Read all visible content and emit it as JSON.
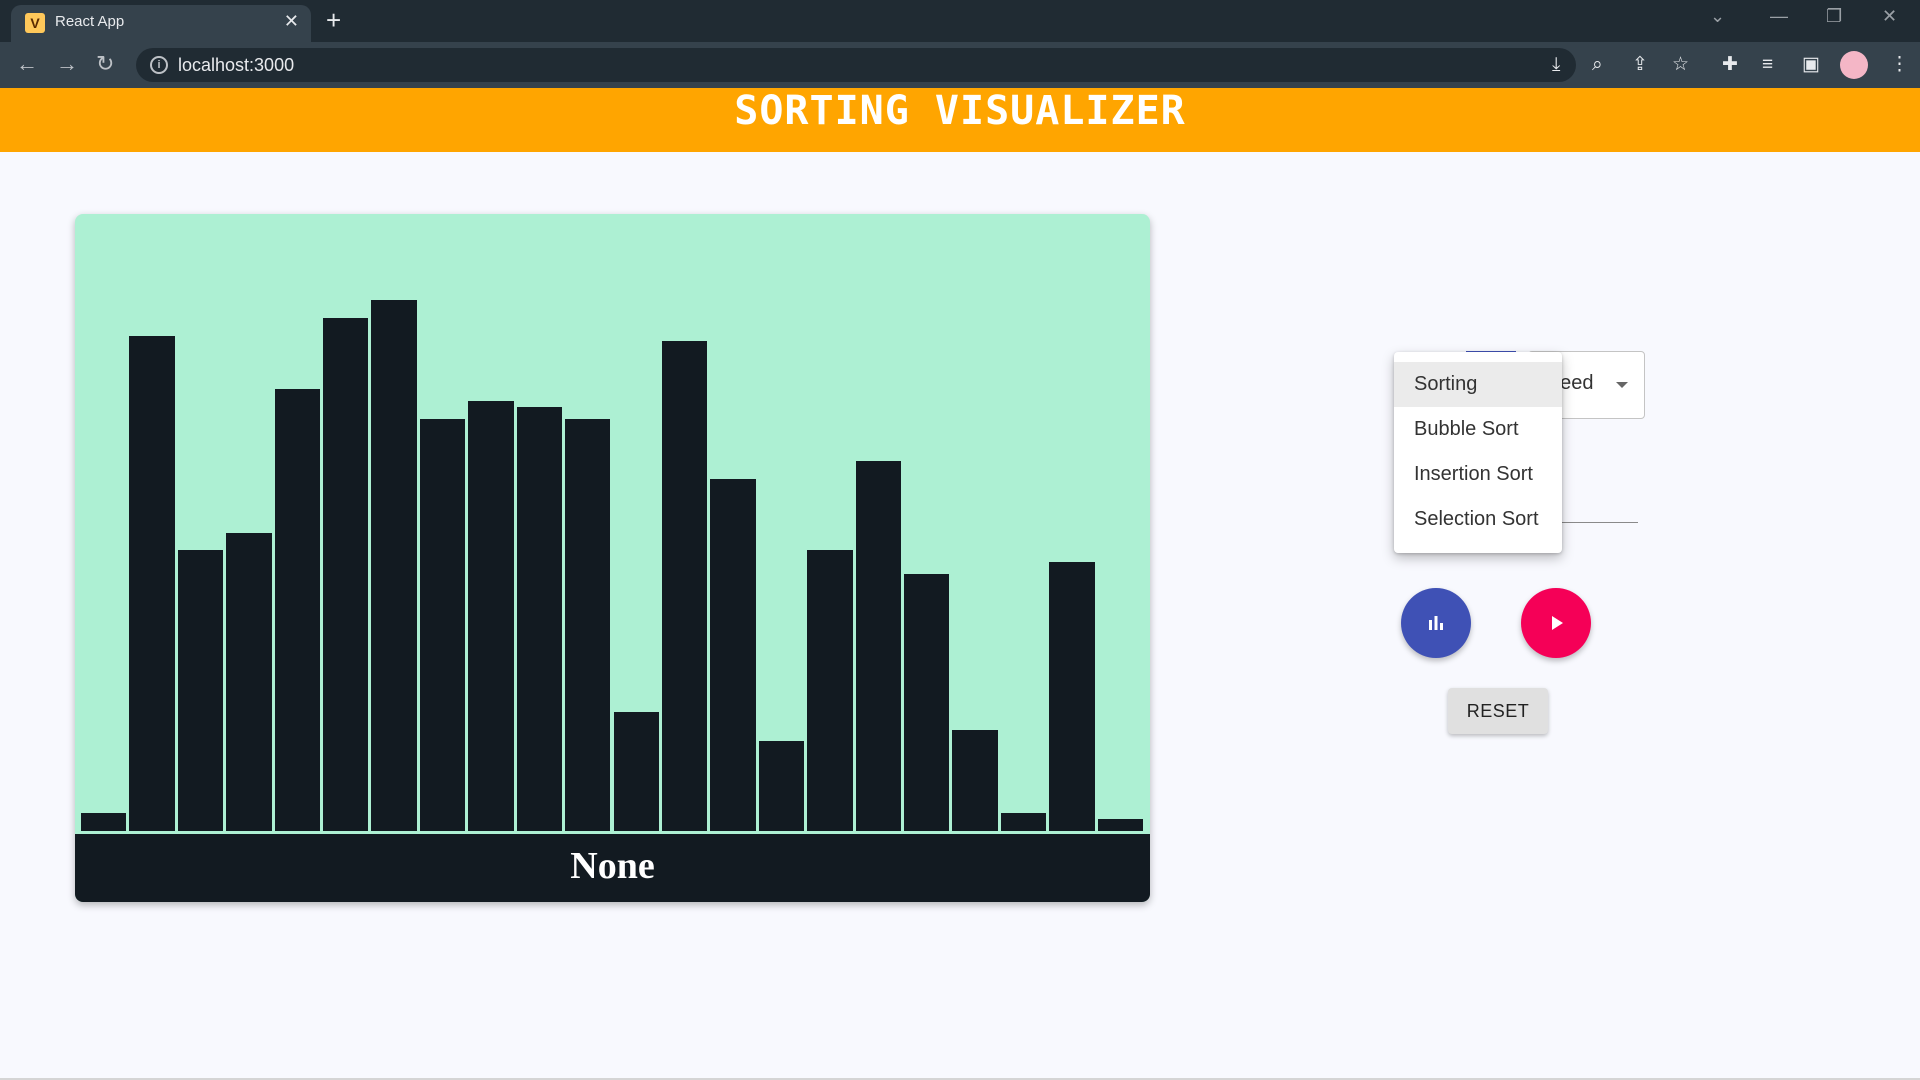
{
  "browser": {
    "tab_icon_letter": "V",
    "tab_title": "React App",
    "url": "localhost:3000"
  },
  "app": {
    "title": "SORTING VISUALIZER",
    "status": "None",
    "bar_color": "#121a21",
    "card_color": "#adf0d3",
    "header_color": "#ffa500"
  },
  "chart_data": {
    "type": "bar",
    "values": [
      3,
      83,
      47,
      50,
      74,
      86,
      89,
      69,
      72,
      71,
      69,
      20,
      82,
      59,
      15,
      47,
      62,
      43,
      17,
      3,
      45,
      2
    ],
    "ylim": [
      0,
      100
    ]
  },
  "controls": {
    "speed_label": "peed",
    "menu_items": [
      "Sorting",
      "Bubble Sort",
      "Insertion Sort",
      "Selection Sort"
    ],
    "selected_index": 0,
    "reset_label": "RESET",
    "generate_icon": "bar-chart-icon",
    "play_icon": "play-icon",
    "blue_color": "#3f51b5",
    "pink_color": "#f50057"
  }
}
